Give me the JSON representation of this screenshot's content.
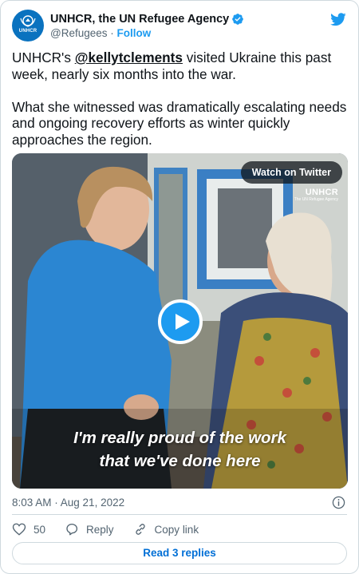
{
  "author": {
    "display_name": "UNHCR, the UN Refugee Agency",
    "handle": "@Refugees",
    "separator": "·",
    "follow_label": "Follow",
    "avatar_text": "UNHCR"
  },
  "tweet": {
    "paragraph1_prefix": "UNHCR's ",
    "mention": "@kellytclements",
    "paragraph1_suffix": " visited Ukraine this past week, nearly six months into the war.",
    "paragraph2": "What she witnessed was dramatically escalating needs and ongoing recovery efforts as winter quickly approaches the region."
  },
  "media": {
    "watch_label": "Watch on Twitter",
    "watermark": "UNHCR",
    "watermark_sub": "The UN Refugee Agency",
    "caption_line1": "I'm really proud of the work",
    "caption_line2": "that we've done here"
  },
  "meta": {
    "timestamp": "8:03 AM · Aug 21, 2022"
  },
  "actions": {
    "like_count": "50",
    "reply_label": "Reply",
    "copy_link_label": "Copy link",
    "read_replies_label": "Read 3 replies"
  },
  "colors": {
    "accent": "#1d9bf0",
    "link_blue": "#006fd6",
    "text_primary": "#0f1419",
    "text_secondary": "#536471",
    "border": "#cfd9de",
    "unhcr_blue": "#0a72bf"
  },
  "icons": [
    "unhcr-logo-icon",
    "verified-badge-icon",
    "twitter-bird-icon",
    "play-icon",
    "info-icon",
    "heart-icon",
    "reply-icon",
    "link-icon"
  ]
}
